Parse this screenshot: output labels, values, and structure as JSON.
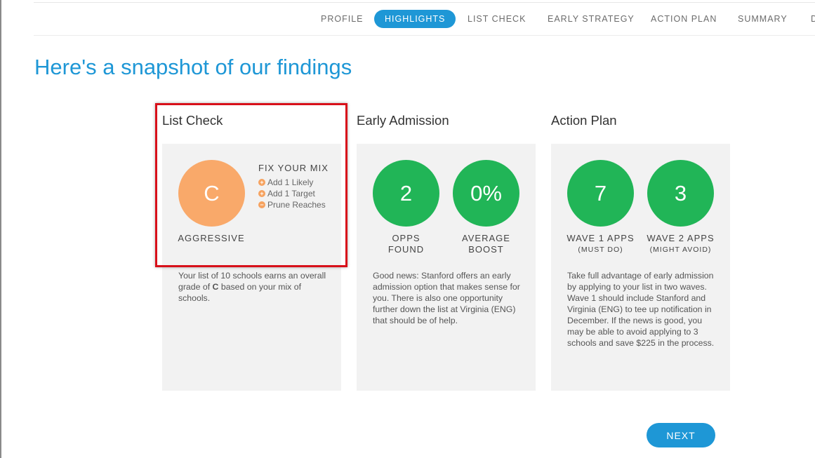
{
  "nav": {
    "items": [
      "PROFILE",
      "HIGHLIGHTS",
      "LIST CHECK",
      "EARLY STRATEGY",
      "ACTION PLAN",
      "SUMMARY",
      "D"
    ],
    "active": "HIGHLIGHTS"
  },
  "page": {
    "title": "Here's a snapshot of our findings"
  },
  "cards": {
    "list_check": {
      "title": "List Check",
      "grade": "C",
      "grade_label": "AGGRESSIVE",
      "fix_title": "FIX YOUR MIX",
      "fix_items": [
        {
          "icon": "plus-circle-icon",
          "text": "Add 1 Likely"
        },
        {
          "icon": "plus-circle-icon",
          "text": "Add 1 Target"
        },
        {
          "icon": "minus-circle-icon",
          "text": "Prune Reaches"
        }
      ],
      "desc_before": "Your list of 10 schools earns an overall grade of ",
      "desc_bold": "C",
      "desc_after": " based on your mix of schools."
    },
    "early_admission": {
      "title": "Early Admission",
      "stat1": {
        "value": "2",
        "label_line1": "OPPS",
        "label_line2": "FOUND"
      },
      "stat2": {
        "value": "0%",
        "label_line1": "AVERAGE",
        "label_line2": "BOOST"
      },
      "desc": "Good news: Stanford offers an early admission option that makes sense for you. There is also one opportunity further down the list at Virginia (ENG) that should be of help."
    },
    "action_plan": {
      "title": "Action Plan",
      "stat1": {
        "value": "7",
        "label": "WAVE 1 APPS",
        "sublabel": "(MUST DO)"
      },
      "stat2": {
        "value": "3",
        "label": "WAVE 2 APPS",
        "sublabel": "(MIGHT AVOID)"
      },
      "desc": "Take full advantage of early admission by applying to your list in two waves. Wave 1 should include Stanford and Virginia (ENG) to tee up notification in December. If the news is good, you may be able to avoid applying to 3 schools and save $225 in the process."
    }
  },
  "next_button": "NEXT",
  "colors": {
    "accent": "#1e97d6",
    "green": "#21b557",
    "orange": "#f9a96a",
    "highlight": "#d8101a"
  }
}
